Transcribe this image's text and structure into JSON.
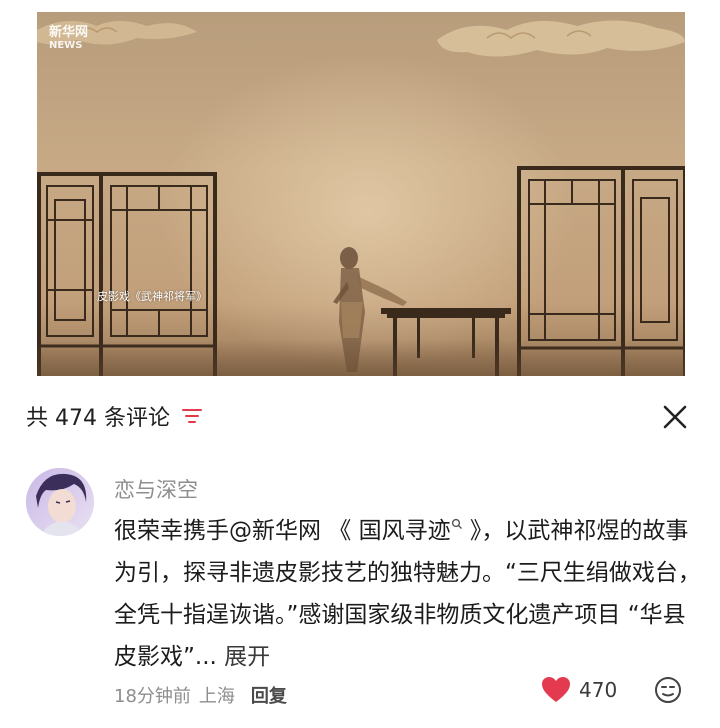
{
  "video": {
    "watermark_logo": "新华网",
    "watermark_sub": "NEWS",
    "caption": "皮影戏《武神祁将军》"
  },
  "sheet": {
    "comment_count": "共 474 条评论",
    "sort_icon": "sort-lines-icon",
    "close_icon": "close-icon"
  },
  "comment": {
    "username": "恋与深空",
    "text_before_mention": "很荣幸携手",
    "mention": "@新华网",
    "topic_open": " 《 ",
    "topic": "国风寻迹",
    "topic_close": " 》，以武神祁煜的故事为引，探寻非遗皮影技艺的独特魅力。“三尺生绢做戏台，全凭十指逞诙谐。”感谢国家级非物质文化遗产项目 “华县皮影戏”",
    "ellipsis": "... ",
    "expand": "展开",
    "time": "18分钟前",
    "location": "上海",
    "reply": "回复",
    "likes": "470",
    "like_icon": "heart-icon",
    "emoji_icon": "emoji-face-icon"
  },
  "colors": {
    "accent_red": "#e33a4f",
    "muted_gray": "#8e8e8e",
    "text_dark": "#1c1c1c"
  }
}
